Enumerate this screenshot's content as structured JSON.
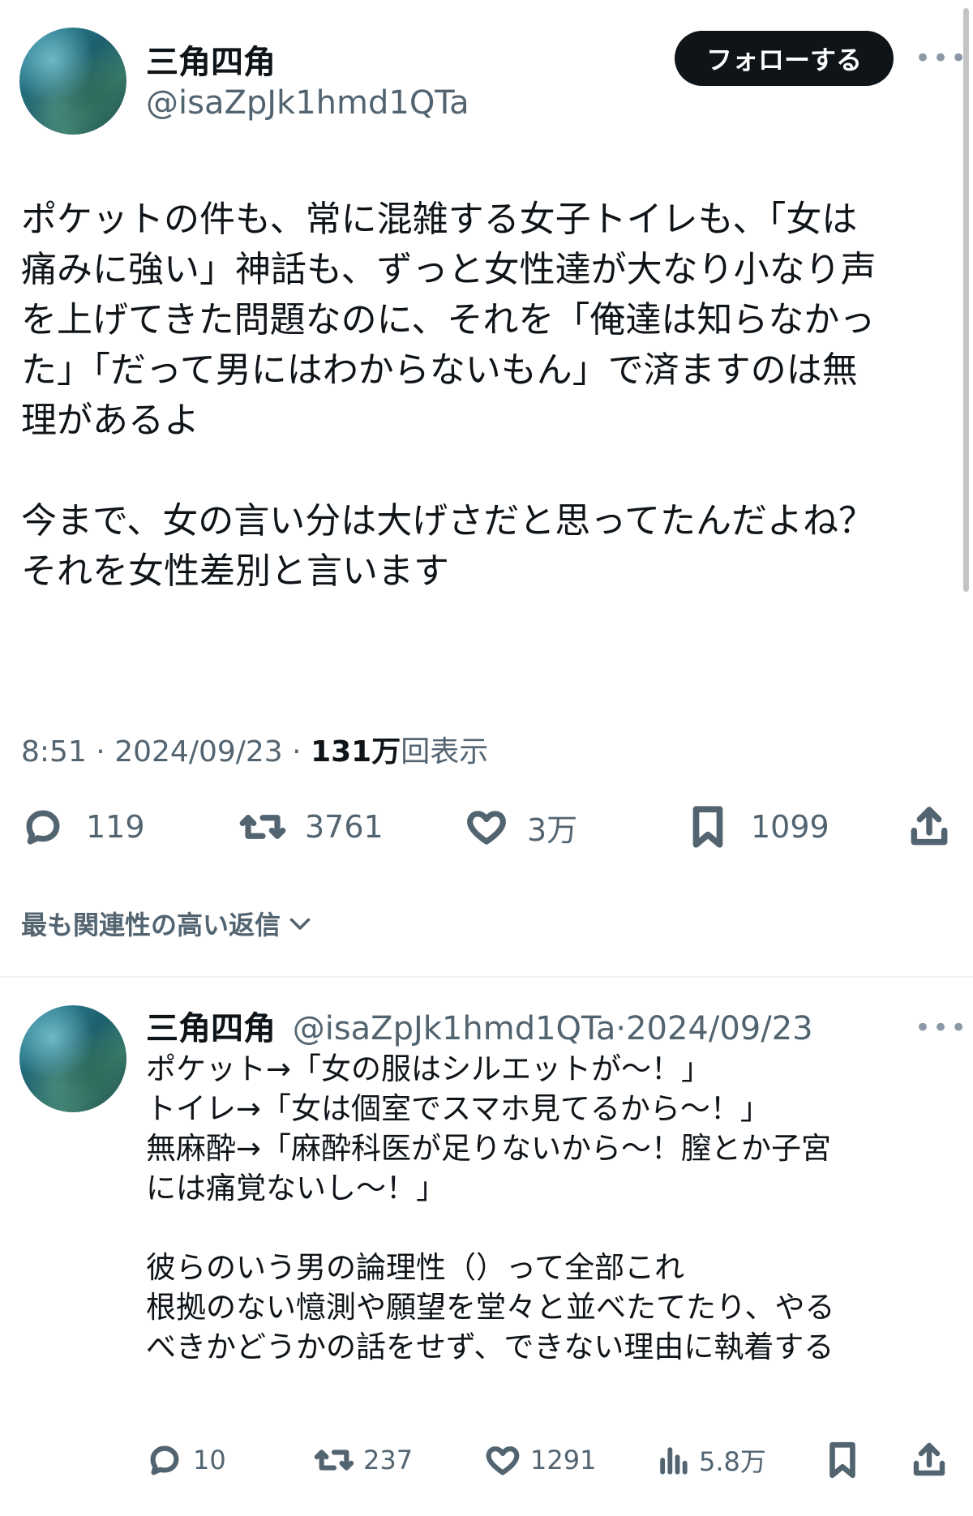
{
  "main_tweet": {
    "author": {
      "name": "三角四角",
      "handle": "@isaZpJk1hmd1QTa"
    },
    "follow_label": "フォローする",
    "more": "•••",
    "text_lines": [
      "ポケットの件も、常に混雑する女子トイレも、「女は",
      "痛みに強い」神話も、ずっと女性達が大なり小なり声",
      "を上げてきた問題なのに、それを「俺達は知らなかっ",
      "た」「だって男にはわからないもん」で済ますのは無",
      "理があるよ",
      "",
      "今まで、女の言い分は大げさだと思ってたんだよね？",
      "それを女性差別と言います"
    ],
    "time": "8:51",
    "separator": "·",
    "date": "2024/09/23",
    "views_count": "131万",
    "views_label": "回表示",
    "actions": {
      "replies": "119",
      "retweets": "3761",
      "likes": "3万",
      "bookmarks": "1099"
    }
  },
  "sort": {
    "label": "最も関連性の高い返信"
  },
  "reply": {
    "author": {
      "name": "三角四角",
      "handle": "@isaZpJk1hmd1QTa",
      "separator": "·",
      "date": "2024/09/23"
    },
    "more": "•••",
    "text_lines": [
      "ポケット→「女の服はシルエットが〜！」",
      "トイレ→「女は個室でスマホ見てるから〜！」",
      "無麻酔→「麻酔科医が足りないから〜！膣とか子宮",
      "には痛覚ないし〜！」",
      "",
      "彼らのいう男の論理性（）って全部これ",
      "根拠のない憶測や願望を堂々と並べたてたり、やる",
      "べきかどうかの話をせず、できない理由に執着する"
    ],
    "actions": {
      "replies": "10",
      "retweets": "237",
      "likes": "1291",
      "views": "5.8万"
    }
  },
  "icons": {
    "reply": "reply-icon",
    "retweet": "retweet-icon",
    "like": "heart-icon",
    "bookmark": "bookmark-icon",
    "share": "share-icon",
    "views": "views-icon",
    "chevron": "chevron-down-icon"
  },
  "colors": {
    "text": "#0f1419",
    "secondary": "#536471",
    "follow_bg": "#0f1419",
    "divider": "#eff3f4"
  }
}
